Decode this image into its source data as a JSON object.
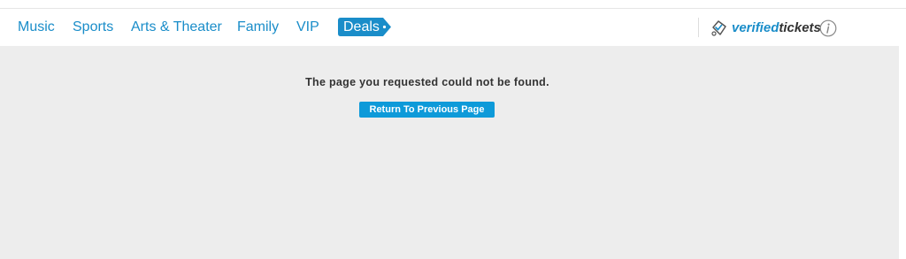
{
  "nav": {
    "items": [
      {
        "label": "Music"
      },
      {
        "label": "Sports"
      },
      {
        "label": "Arts & Theater"
      },
      {
        "label": "Family"
      },
      {
        "label": "VIP"
      }
    ],
    "deals_label": "Deals"
  },
  "brand": {
    "verified": "verified",
    "tickets": "tickets",
    "icon": "ticket-check-icon",
    "info_icon": "info-icon"
  },
  "main": {
    "message": "The page you requested could not be found.",
    "return_label": "Return To Previous Page"
  },
  "colors": {
    "accent": "#1a8dc9",
    "button": "#0e9ad9",
    "background": "#ededed",
    "text": "#333333"
  }
}
